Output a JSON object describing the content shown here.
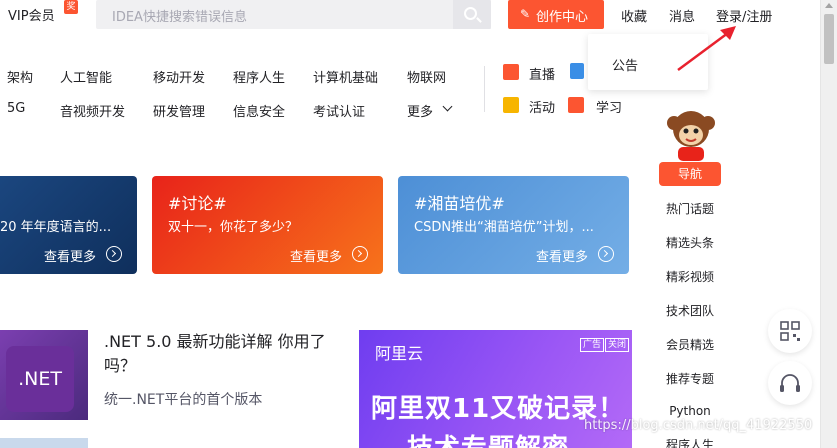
{
  "toolbar": {
    "vip_label": "VIP会员",
    "vip_badge": "奖",
    "search_placeholder": "IDEA快捷搜索错误信息",
    "create_label": "创作中心",
    "nav": [
      "收藏",
      "消息",
      "登录/注册"
    ]
  },
  "dropdown": {
    "item": "公告"
  },
  "categories": {
    "row1": [
      "架构",
      "人工智能",
      "移动开发",
      "程序人生",
      "计算机基础",
      "物联网"
    ],
    "row2": [
      "5G",
      "音视频开发",
      "研发管理",
      "信息安全",
      "考试认证",
      "更多"
    ]
  },
  "quick_links": [
    "直播",
    "活动",
    "学习"
  ],
  "cards": [
    {
      "title": "",
      "subtitle": "20 年年度语言的...",
      "more": "查看更多"
    },
    {
      "title": "#讨论#",
      "subtitle": "双十一，你花了多少？",
      "more": "查看更多"
    },
    {
      "title": "#湘苗培优#",
      "subtitle": "CSDN推出“湘苗培优”计划，...",
      "more": "查看更多"
    }
  ],
  "article": {
    "thumb_label": ".NET",
    "title": ".NET 5.0 最新功能详解 你用了吗？",
    "subtitle": "统一.NET平台的首个版本"
  },
  "ad": {
    "logo": "阿里云",
    "tag1": "广告",
    "tag2": "关闭",
    "headline": "阿里双11又破记录！",
    "headline2": "技术专题解密"
  },
  "sidebar": {
    "badge": "导航",
    "items": [
      "热门话题",
      "精选头条",
      "精彩视频",
      "技术团队",
      "会员精选",
      "推荐专题",
      "Python",
      "程序人生"
    ]
  },
  "watermark": "https://blog.csdn.net/qq_41922550",
  "colors": {
    "brand": "#fc5531",
    "card2": "#f24b12",
    "card3": "#5a9ad8"
  }
}
